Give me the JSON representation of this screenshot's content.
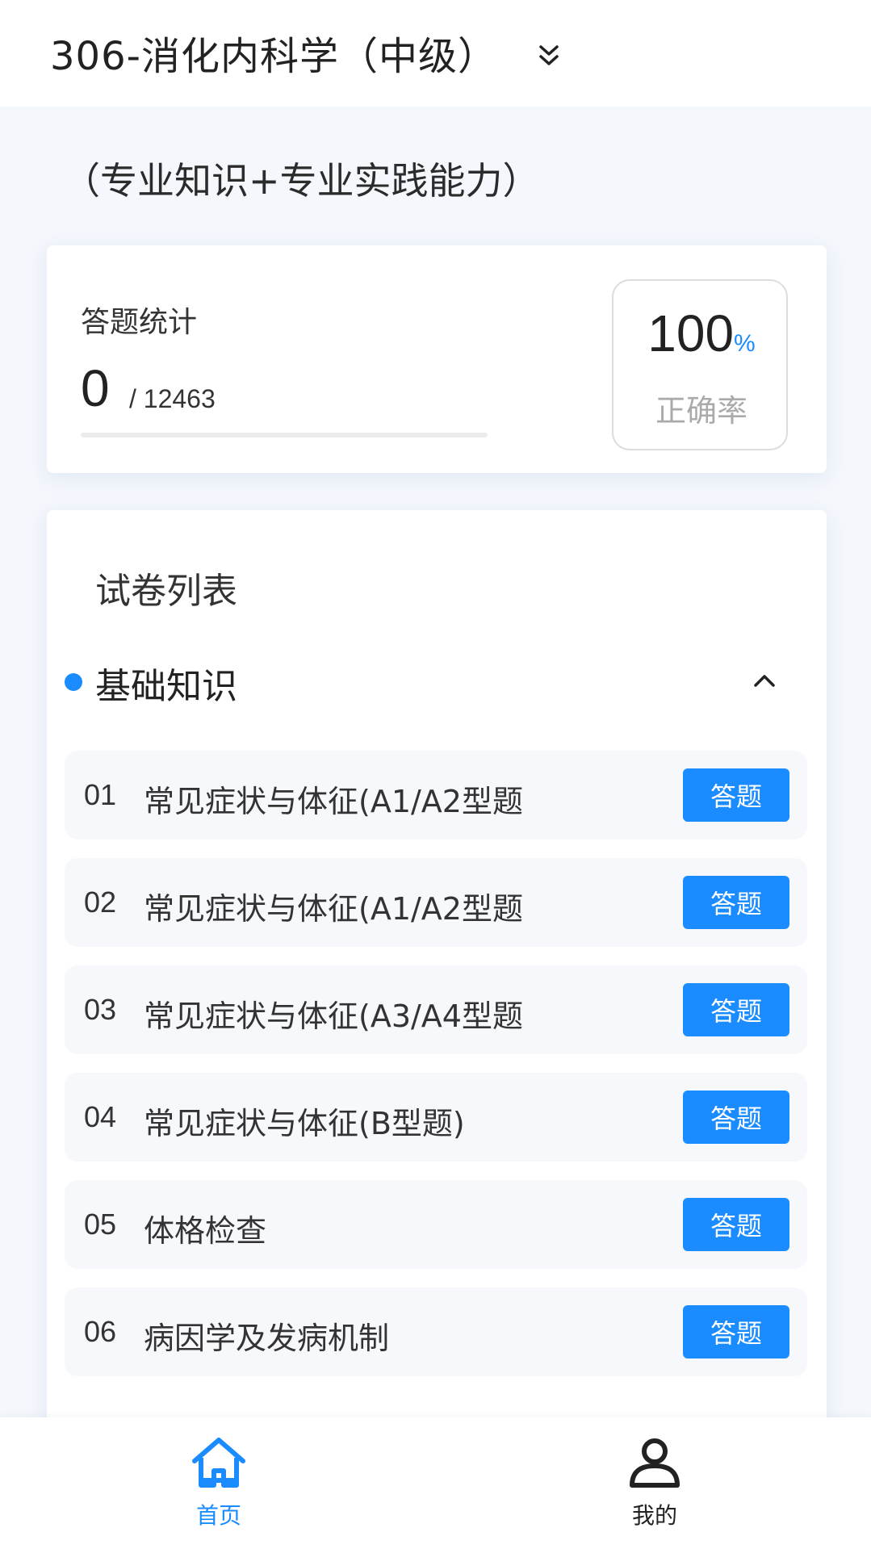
{
  "header": {
    "title": "306-消化内科学（中级）",
    "dropdown_icon": "double-chevron-down-icon"
  },
  "subtitle": "（专业知识+专业实践能力）",
  "stats": {
    "label": "答题统计",
    "answered": "0",
    "total": "/ 12463",
    "progress": 0,
    "accuracy_value": "100",
    "accuracy_unit": "%",
    "accuracy_label": "正确率"
  },
  "paper_list": {
    "title": "试卷列表",
    "section": {
      "label": "基础知识",
      "expanded": true,
      "chevron_icon": "chevron-up-icon"
    },
    "items": [
      {
        "num": "01",
        "name": "常见症状与体征(A1/A2型题",
        "action": "答题"
      },
      {
        "num": "02",
        "name": "常见症状与体征(A1/A2型题",
        "action": "答题"
      },
      {
        "num": "03",
        "name": "常见症状与体征(A3/A4型题",
        "action": "答题"
      },
      {
        "num": "04",
        "name": "常见症状与体征(B型题)",
        "action": "答题"
      },
      {
        "num": "05",
        "name": "体格检查",
        "action": "答题"
      },
      {
        "num": "06",
        "name": "病因学及发病机制",
        "action": "答题"
      }
    ]
  },
  "bottom_nav": {
    "home": {
      "label": "首页",
      "icon": "home-icon",
      "active": true
    },
    "mine": {
      "label": "我的",
      "icon": "user-icon",
      "active": false
    }
  },
  "colors": {
    "accent": "#1a8cff",
    "background": "#f4f7fc"
  }
}
